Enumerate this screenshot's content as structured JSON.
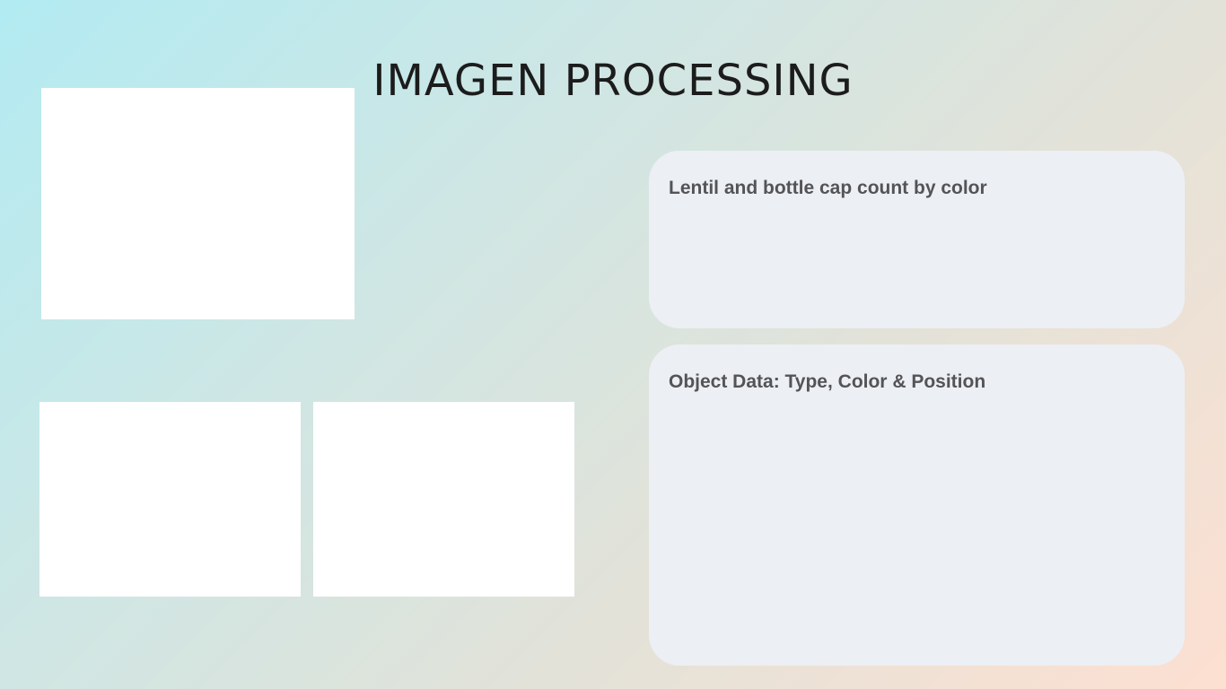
{
  "header": {
    "title": "IMAGEN PROCESSING"
  },
  "panels": {
    "count_panel": {
      "title": "Lentil and bottle cap count by color"
    },
    "objects_panel": {
      "title": "Object Data: Type, Color & Position"
    }
  },
  "colors": {
    "panel_background": "#eceff4",
    "title_text": "#1c1c1c",
    "panel_title_text": "#545457",
    "image_frame": "#ffffff"
  }
}
